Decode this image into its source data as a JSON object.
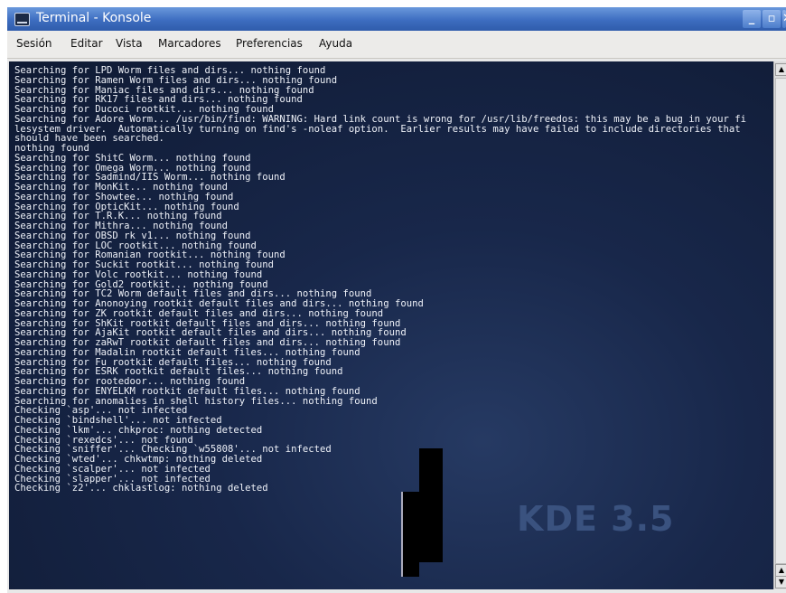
{
  "window": {
    "title": "Terminal - Konsole",
    "buttons": {
      "minimize": "_",
      "maximize": "▫",
      "close": "✕"
    }
  },
  "menubar": {
    "items": [
      "Sesión",
      "Editar",
      "Vista",
      "Marcadores",
      "Preferencias",
      "Ayuda"
    ]
  },
  "terminal": {
    "lines": [
      "Searching for LPD Worm files and dirs... nothing found",
      "Searching for Ramen Worm files and dirs... nothing found",
      "Searching for Maniac files and dirs... nothing found",
      "Searching for RK17 files and dirs... nothing found",
      "Searching for Ducoci rootkit... nothing found",
      "Searching for Adore Worm... /usr/bin/find: WARNING: Hard link count is wrong for /usr/lib/freedos: this may be a bug in your fi",
      "lesystem driver.  Automatically turning on find's -noleaf option.  Earlier results may have failed to include directories that",
      "should have been searched.",
      "nothing found",
      "Searching for ShitC Worm... nothing found",
      "Searching for Omega Worm... nothing found",
      "Searching for Sadmind/IIS Worm... nothing found",
      "Searching for MonKit... nothing found",
      "Searching for Showtee... nothing found",
      "Searching for OpticKit... nothing found",
      "Searching for T.R.K... nothing found",
      "Searching for Mithra... nothing found",
      "Searching for OBSD rk v1... nothing found",
      "Searching for LOC rootkit... nothing found",
      "Searching for Romanian rootkit... nothing found",
      "Searching for Suckit rootkit... nothing found",
      "Searching for Volc rootkit... nothing found",
      "Searching for Gold2 rootkit... nothing found",
      "Searching for TC2 Worm default files and dirs... nothing found",
      "Searching for Anonoying rootkit default files and dirs... nothing found",
      "Searching for ZK rootkit default files and dirs... nothing found",
      "Searching for ShKit rootkit default files and dirs... nothing found",
      "Searching for AjaKit rootkit default files and dirs... nothing found",
      "Searching for zaRwT rootkit default files and dirs... nothing found",
      "Searching for Madalin rootkit default files... nothing found",
      "Searching for Fu rootkit default files... nothing found",
      "Searching for ESRK rootkit default files... nothing found",
      "Searching for rootedoor... nothing found",
      "Searching for ENYELKM rootkit default files... nothing found",
      "Searching for anomalies in shell history files... nothing found",
      "Checking `asp'... not infected",
      "Checking `bindshell'... not infected",
      "Checking `lkm'... chkproc: nothing detected",
      "Checking `rexedcs'... not found",
      "Checking `sniffer'... Checking `w55808'... not infected",
      "Checking `wted'... chkwtmp: nothing deleted",
      "Checking `scalper'... not infected",
      "Checking `slapper'... not infected",
      "Checking `z2'... chklastlog: nothing deleted"
    ],
    "watermark": "KDE 3.5"
  },
  "scrollbar": {
    "up_arrow": "▲",
    "down_arrow": "▼"
  },
  "colors": {
    "titlebar": "#3d6dc0",
    "terminal_background": "#15213f",
    "terminal_text": "#eef1f8"
  }
}
